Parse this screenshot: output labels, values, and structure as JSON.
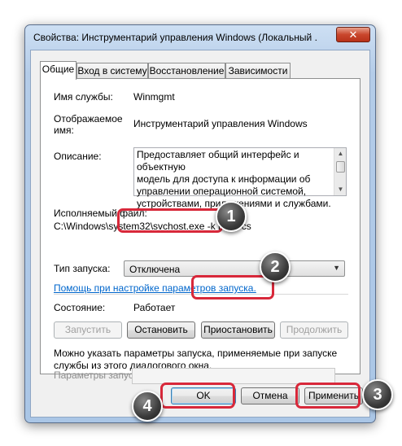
{
  "window": {
    "title": "Свойства: Инструментарий управления Windows (Локальный ..."
  },
  "tabs": [
    {
      "label": "Общие",
      "active": true
    },
    {
      "label": "Вход в систему",
      "active": false
    },
    {
      "label": "Восстановление",
      "active": false
    },
    {
      "label": "Зависимости",
      "active": false
    }
  ],
  "general": {
    "service_name_label": "Имя службы:",
    "service_name_value": "Winmgmt",
    "display_name_label_line1": "Отображаемое",
    "display_name_label_line2": "имя:",
    "display_name_value": "Инструментарий управления Windows",
    "description_label": "Описание:",
    "description_lines": [
      "Предоставляет общий интерфейс и объектную",
      "модель для доступа к информации об",
      "управлении операционной системой,",
      "устройствами, приложениями и службами."
    ],
    "exe_label": "Исполняемый файл:",
    "exe_value": "C:\\Windows\\system32\\svchost.exe -k netsvcs",
    "startup_type_label": "Тип запуска:",
    "startup_type_value": "Отключена",
    "help_link": "Помощь при настройке параметров запуска.",
    "state_label": "Состояние:",
    "state_value": "Работает",
    "start_params_note_line1": "Можно указать параметры запуска, применяемые при запуске",
    "start_params_note_line2": "службы из этого диалогового окна.",
    "start_params_label": "Параметры запуска:",
    "start_params_value": ""
  },
  "service_buttons": {
    "start": "Запустить",
    "stop": "Остановить",
    "pause": "Приостановить",
    "resume": "Продолжить"
  },
  "dialog_buttons": {
    "ok": "OK",
    "cancel": "Отмена",
    "apply": "Применить"
  },
  "annotations": {
    "badge_1": "1",
    "badge_2": "2",
    "badge_3": "3",
    "badge_4": "4"
  },
  "colors": {
    "highlight": "#d8283a",
    "link": "#0066cc"
  }
}
